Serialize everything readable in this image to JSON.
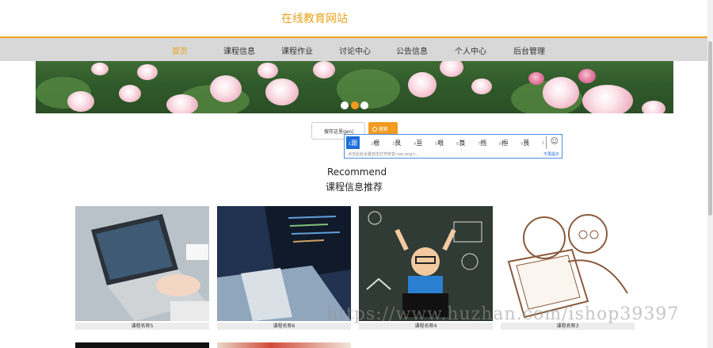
{
  "site": {
    "title": "在线教育网站"
  },
  "nav": {
    "items": [
      {
        "label": "首页",
        "active": true
      },
      {
        "label": "课程信息",
        "active": false
      },
      {
        "label": "课程作业",
        "active": false
      },
      {
        "label": "讨论中心",
        "active": false
      },
      {
        "label": "公告信息",
        "active": false
      },
      {
        "label": "个人中心",
        "active": false
      },
      {
        "label": "后台管理",
        "active": false
      }
    ]
  },
  "banner": {
    "active_slide": 2,
    "slide_count": 3
  },
  "search": {
    "value": "搜存这里gen|",
    "button_label": "搜索",
    "button_icon": "search-icon"
  },
  "ime": {
    "candidates": [
      {
        "num": "1",
        "text": "跟"
      },
      {
        "num": "2",
        "text": "根"
      },
      {
        "num": "3",
        "text": "艮"
      },
      {
        "num": "4",
        "text": "亘"
      },
      {
        "num": "5",
        "text": "哏"
      },
      {
        "num": "6",
        "text": "莨"
      },
      {
        "num": "7",
        "text": "揯"
      },
      {
        "num": "8",
        "text": "搄"
      },
      {
        "num": "9",
        "text": "茛"
      },
      {
        "num": "1",
        "text": ""
      }
    ],
    "tip": "点击此处设置双击打开拼音<en,eng>。",
    "link": "不再提示",
    "emoji_icon": "smiley-icon"
  },
  "recommend": {
    "title_en": "Recommend",
    "title_zh": "课程信息推荐"
  },
  "courses": [
    {
      "name": "课程名称5"
    },
    {
      "name": "课程名称6"
    },
    {
      "name": "课程名称4"
    },
    {
      "name": "课程名称3"
    }
  ],
  "watermark": "https://www.huzhan.com/ishop39397",
  "colors": {
    "accent": "#f29b1f",
    "nav_bg": "#d8d8d8",
    "title": "#e8a21a"
  }
}
